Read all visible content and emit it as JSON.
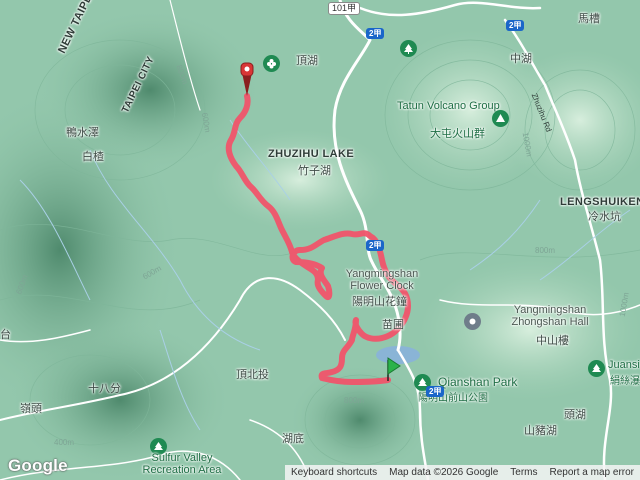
{
  "map": {
    "labels": {
      "new_taipei_city": "NEW TAIPEI CITY",
      "taipei_city": "TAIPEI CITY",
      "zhuzihu_lake": "ZHUZIHU LAKE",
      "zhuzihu_lake_zh": "竹子湖",
      "dinghu": "頂湖",
      "zhonghu": "中湖",
      "matsao": "馬槽",
      "tatun_group": "Tatun Volcano Group",
      "tatun_group_zh": "大屯火山群",
      "zhuzihu_rd": "Zhuzihu Rd",
      "lengshuikeng": "LENGSHUIKENG",
      "lengshuikeng_zh": "冷水坑",
      "flower_clock": "Yangmingshan Flower Clock",
      "flower_clock_zh": "陽明山花鐘",
      "miaopu": "苗圃",
      "zhongshan_hall": "Yangmingshan Zhongshan Hall",
      "zhongshan_hall_zh": "中山樓",
      "qianshan_park": "Qianshan Park",
      "qianshan_park_zh": "陽明山前山公園",
      "juansi": "Juansi",
      "juansi_zh": "絹絲瀑",
      "shuiduo": "鴨水澤",
      "baihu": "白楂",
      "shibafen": "十八分",
      "tingtou": "嶺頭",
      "dingbeitou": "頂北投",
      "hudi": "湖底",
      "toujiao": "頭湖",
      "shanzhuhu": "山豬湖",
      "sulfur_valley": "Sulfur Valley Recreation Area",
      "tai": "台"
    },
    "road_shields": {
      "r101": "101甲",
      "r2a_top": "2甲",
      "r2a_right": "2甲",
      "r2a_mid": "2甲",
      "r2a_bottom": "2甲"
    },
    "contours": {
      "c1": "800m",
      "c2": "600m",
      "c3": "800m",
      "c4": "1000m",
      "c5": "600m",
      "c6": "400m",
      "c7": "600m",
      "c8": "800m",
      "c9": "1000m"
    },
    "colors": {
      "track": "#f0546a",
      "terrain_light": "#b9dcc6",
      "terrain_mid": "#8fc4a8",
      "terrain_dark": "#5e9a7c",
      "road": "#ffffff",
      "water": "#8ab4d6",
      "poi_green": "#1f8a52",
      "start_marker": "#2bb24a",
      "end_marker": "#d93636"
    },
    "markers": {
      "start": "green-flag-marker",
      "end": "red-pin-marker"
    },
    "logo": "Google",
    "attribution": {
      "keyboard_shortcuts": "Keyboard shortcuts",
      "map_data": "Map data ©2026 Google",
      "terms": "Terms",
      "report": "Report a map error"
    }
  }
}
